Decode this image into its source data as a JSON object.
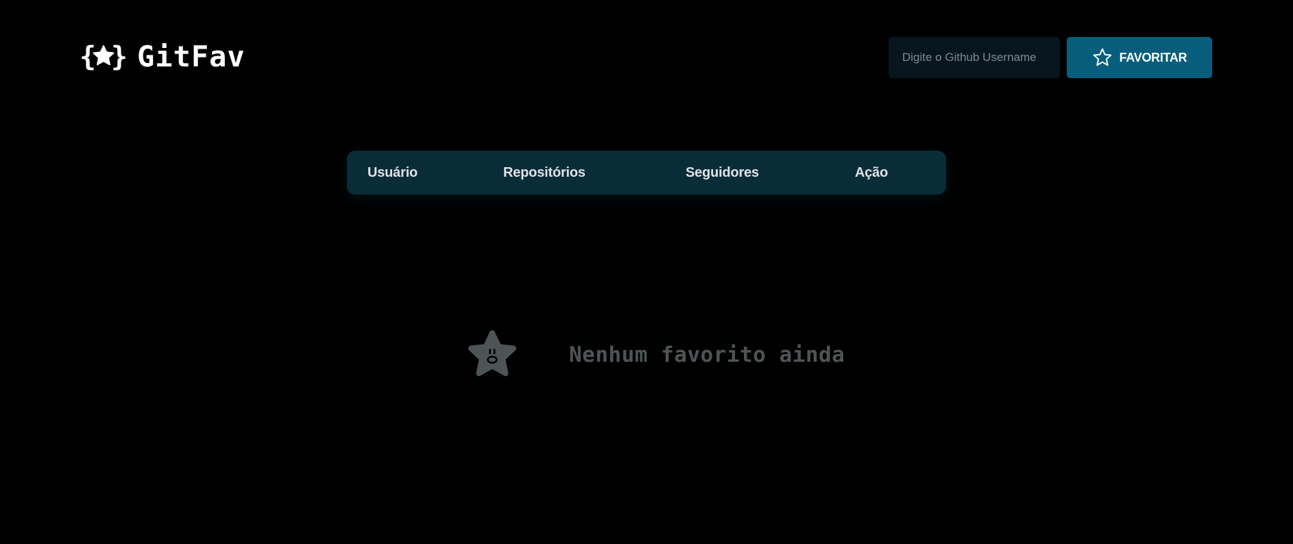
{
  "header": {
    "logo_text": "GitFav",
    "search": {
      "placeholder": "Digite o Github Username",
      "value": ""
    },
    "favorite_button_label": "FAVORITAR"
  },
  "table": {
    "columns": [
      "Usuário",
      "Repositórios",
      "Seguidores",
      "Ação"
    ]
  },
  "empty_state": {
    "icon": "sad-star-icon",
    "message": "Nenhum favorito ainda"
  },
  "colors": {
    "background": "#000000",
    "accent": "#065e7c",
    "table_header": "#092d38",
    "input_background": "#06161c",
    "muted_text": "#4e5455"
  }
}
